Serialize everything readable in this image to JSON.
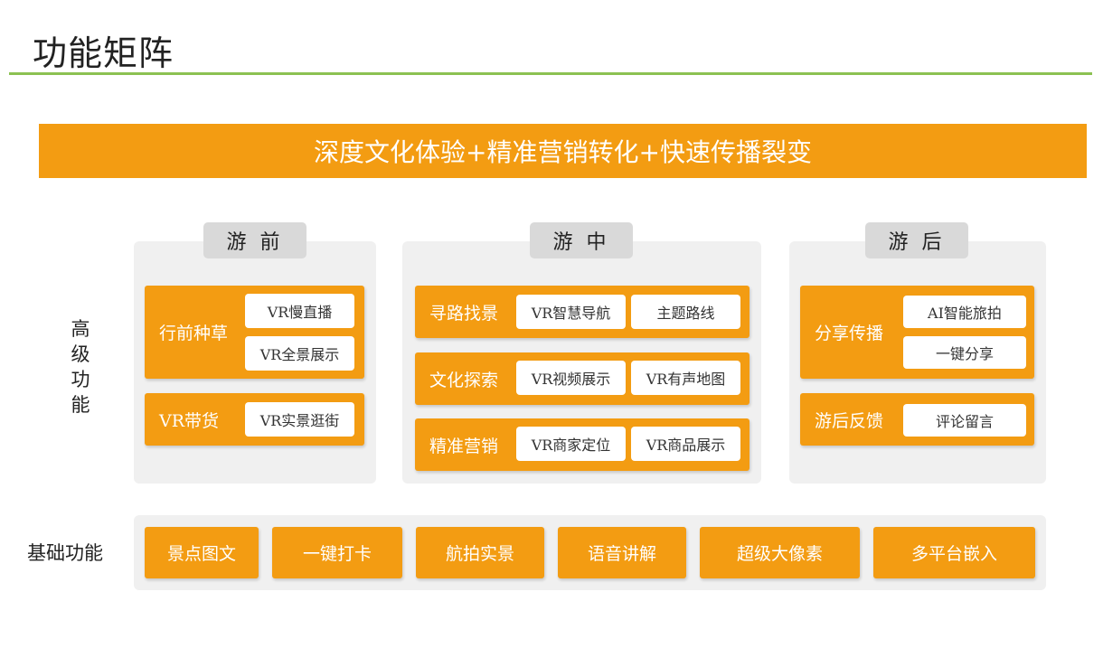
{
  "page_title": "功能矩阵",
  "banner": "深度文化体验+精准营销转化+快速传播裂变",
  "labels": {
    "advanced": [
      "高",
      "级",
      "功",
      "能"
    ],
    "basic": "基础功能"
  },
  "phases": [
    {
      "tab": "游 前",
      "groups": [
        {
          "name": "行前种草",
          "items": [
            "VR慢直播",
            "VR全景展示"
          ]
        },
        {
          "name": "VR带货",
          "items": [
            "VR实景逛街"
          ]
        }
      ]
    },
    {
      "tab": "游 中",
      "groups": [
        {
          "name": "寻路找景",
          "items": [
            "VR智慧导航",
            "主题路线"
          ]
        },
        {
          "name": "文化探索",
          "items": [
            "VR视频展示",
            "VR有声地图"
          ]
        },
        {
          "name": "精准营销",
          "items": [
            "VR商家定位",
            "VR商品展示"
          ]
        }
      ]
    },
    {
      "tab": "游 后",
      "groups": [
        {
          "name": "分享传播",
          "items": [
            "AI智能旅拍",
            "一键分享"
          ]
        },
        {
          "name": "游后反馈",
          "items": [
            "评论留言"
          ]
        }
      ]
    }
  ],
  "basic_features": [
    "景点图文",
    "一键打卡",
    "航拍实景",
    "语音讲解",
    "超级大像素",
    "多平台嵌入"
  ],
  "colors": {
    "orange": "#f39c12",
    "green_rule": "#8cc152",
    "panel_gray": "#f0f0f0",
    "tab_gray": "#d9d9d9"
  }
}
